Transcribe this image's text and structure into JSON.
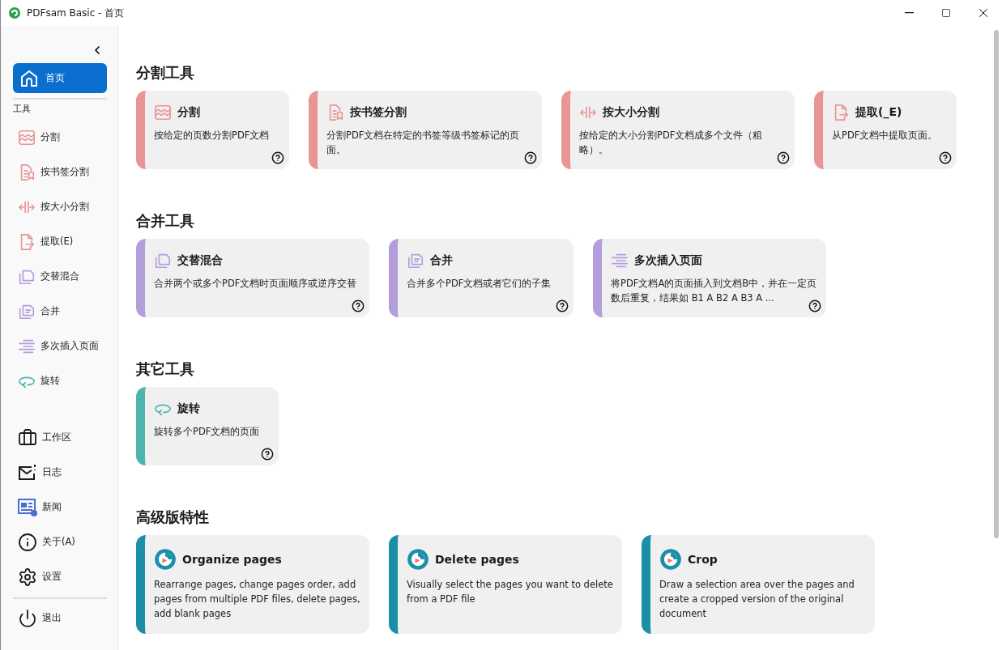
{
  "window": {
    "title": "PDFsam Basic - 首页"
  },
  "sidebar": {
    "home": {
      "label": "首页",
      "selected": true
    },
    "tools_label": "工具",
    "tools": [
      {
        "label": "分割",
        "kind": "split",
        "selected": false
      },
      {
        "label": "按书签分割",
        "kind": "bookmark",
        "selected": false
      },
      {
        "label": "按大小分割",
        "kind": "size",
        "selected": false
      },
      {
        "label": "提取(E)",
        "kind": "extract",
        "selected": false
      },
      {
        "label": "交替混合",
        "kind": "alternate",
        "selected": false
      },
      {
        "label": "合并",
        "kind": "merge",
        "selected": false
      },
      {
        "label": "多次插入页面",
        "kind": "insert",
        "selected": false
      },
      {
        "label": "旋转",
        "kind": "rotate",
        "selected": false
      }
    ],
    "bottom": [
      {
        "label": "工作区",
        "kind": "workspace",
        "selected": false
      },
      {
        "label": "日志",
        "kind": "log",
        "selected": false
      },
      {
        "label": "新闻",
        "kind": "news",
        "selected": false
      },
      {
        "label": "关于(A)",
        "kind": "about",
        "selected": false
      },
      {
        "label": "设置",
        "kind": "settings",
        "selected": false
      }
    ],
    "exit": {
      "label": "退出"
    }
  },
  "sections": [
    {
      "title": "分割工具",
      "kind": "split",
      "cards": [
        {
          "title": "分割",
          "kind": "split",
          "description": "按给定的页数分割PDF文档"
        },
        {
          "title": "按书签分割",
          "kind": "bookmark",
          "description": "分割PDF文档在特定的书签等级书签标记的页面。"
        },
        {
          "title": "按大小分割",
          "kind": "size",
          "description": "按给定的大小分割PDF文档成多个文件（粗略）。"
        },
        {
          "title": "提取(_E)",
          "kind": "extract",
          "description": "从PDF文档中提取页面。"
        }
      ]
    },
    {
      "title": "合并工具",
      "kind": "merge",
      "cards": [
        {
          "title": "交替混合",
          "kind": "alternate",
          "description": "合并两个或多个PDF文档时页面顺序或逆序交替"
        },
        {
          "title": "合并",
          "kind": "merge",
          "description": "合并多个PDF文档或者它们的子集"
        },
        {
          "title": "多次插入页面",
          "kind": "insert",
          "description": "将PDF文档A的页面插入到文档B中，并在一定页数后重复，结果如 B1 A B2 A B3 A ..."
        }
      ]
    },
    {
      "title": "其它工具",
      "kind": "other",
      "cards": [
        {
          "title": "旋转",
          "kind": "rotate",
          "description": "旋转多个PDF文档的页面"
        }
      ]
    },
    {
      "title": "高级版特性",
      "kind": "premium",
      "cards": [
        {
          "title": "Organize pages",
          "kind": "premium",
          "description": "Rearrange pages, change pages order, add pages from multiple PDF files, delete pages, add blank pages"
        },
        {
          "title": "Delete pages",
          "kind": "premium",
          "description": "Visually select the pages you want to delete from a PDF file"
        },
        {
          "title": "Crop",
          "kind": "premium",
          "description": "Draw a selection area over the pages and create a cropped version of the original document"
        }
      ]
    }
  ]
}
